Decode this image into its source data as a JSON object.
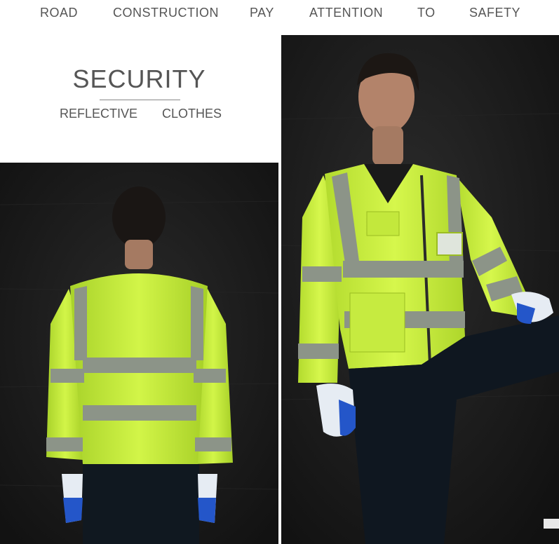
{
  "slogan": {
    "words": [
      "ROAD",
      "CONSTRUCTION",
      "PAY",
      "ATTENTION",
      "TO",
      "SAFETY"
    ]
  },
  "title": {
    "main": "SECURITY",
    "sub_left": "REFLECTIVE",
    "sub_right": "CLOTHES"
  },
  "photos": {
    "back_view": {
      "subject": "model-back-view"
    },
    "front_view": {
      "subject": "model-front-view"
    }
  },
  "colors": {
    "text": "#555555",
    "vest_yellow": "#c9f23a",
    "reflective_strip": "#8c9488",
    "wall_dark": "#1b1b1b",
    "glove_blue": "#2456c9"
  }
}
